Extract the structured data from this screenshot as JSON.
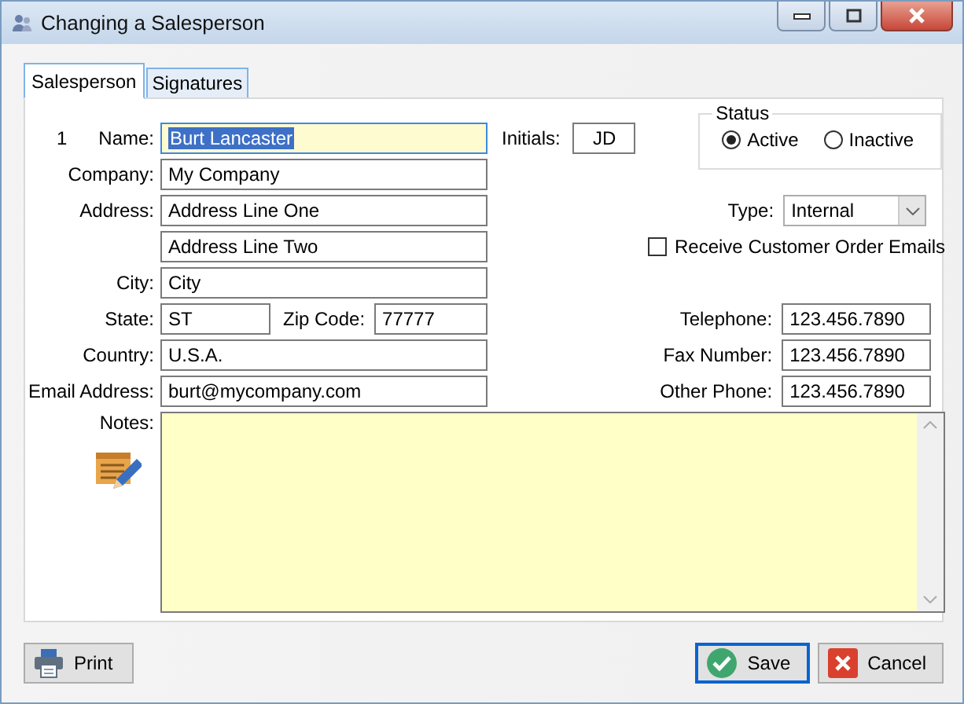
{
  "window": {
    "title": "Changing a Salesperson"
  },
  "tabs": [
    {
      "label": "Salesperson",
      "selected": true
    },
    {
      "label": "Signatures",
      "selected": false
    }
  ],
  "record_number": "1",
  "name": {
    "label": "Name:",
    "value": "Burt Lancaster",
    "focused": true
  },
  "initials": {
    "label": "Initials:",
    "value": "JD"
  },
  "status": {
    "title": "Status",
    "options": [
      {
        "label": "Active",
        "selected": true
      },
      {
        "label": "Inactive",
        "selected": false
      }
    ]
  },
  "company": {
    "label": "Company:",
    "value": "My Company"
  },
  "address": {
    "label": "Address:",
    "lines": [
      "Address Line One",
      "Address Line Two"
    ]
  },
  "type": {
    "label": "Type:",
    "value": "Internal"
  },
  "receive_emails": {
    "label": "Receive Customer Order Emails",
    "checked": false
  },
  "city": {
    "label": "City:",
    "value": "City"
  },
  "state": {
    "label": "State:",
    "value": "ST"
  },
  "zip_code": {
    "label": "Zip Code:",
    "value": "77777"
  },
  "country": {
    "label": "Country:",
    "value": "U.S.A."
  },
  "email_address": {
    "label": "Email Address:",
    "value": "burt@mycompany.com"
  },
  "telephone": {
    "label": "Telephone:",
    "value": "123.456.7890"
  },
  "fax_number": {
    "label": "Fax Number:",
    "value": "123.456.7890"
  },
  "other_phone": {
    "label": "Other Phone:",
    "value": "123.456.7890"
  },
  "notes": {
    "label": "Notes:"
  },
  "buttons": [
    {
      "label": "Print",
      "kind": "print",
      "default": false
    },
    {
      "label": "Save",
      "kind": "save",
      "default": true
    },
    {
      "label": "Cancel",
      "kind": "cancel",
      "default": false
    }
  ]
}
